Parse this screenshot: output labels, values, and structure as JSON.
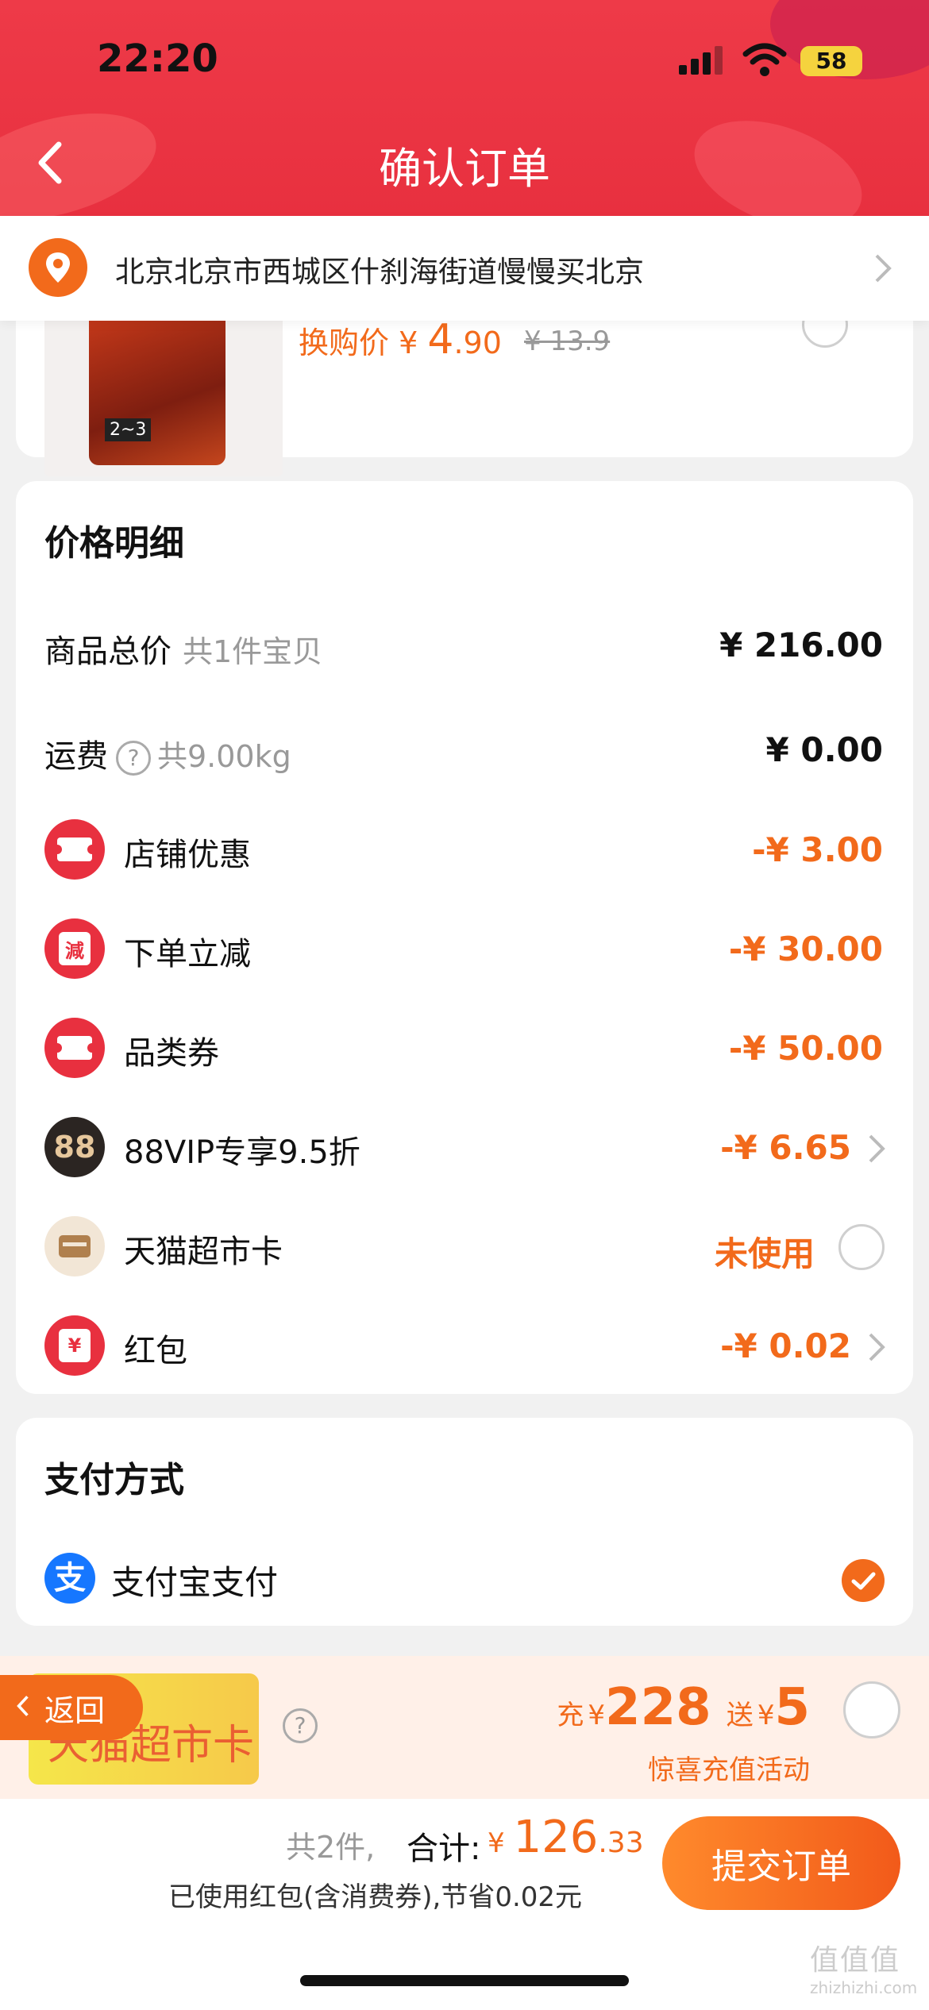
{
  "status_bar": {
    "time": "22:20",
    "battery": "58"
  },
  "header": {
    "title": "确认订单"
  },
  "address": {
    "text": "北京北京市西城区什刹海街道慢慢买北京"
  },
  "product": {
    "swap_label": "换购价 ¥ ",
    "swap_price_int": "4",
    "swap_price_dec": ".90",
    "old_price": "¥ 13.9"
  },
  "price_detail": {
    "title": "价格明细",
    "goods_total_label": "商品总价",
    "goods_total_sub": "共1件宝贝",
    "goods_total_value": "¥ 216.00",
    "shipping_label": "运费",
    "shipping_sub": "共9.00kg",
    "shipping_value": "¥ 0.00",
    "items": [
      {
        "icon": "ticket-icon",
        "label": "店铺优惠",
        "value": "-¥ 3.00"
      },
      {
        "icon": "reduce-icon",
        "icon_text": "減",
        "label": "下单立减",
        "value": "-¥ 30.00"
      },
      {
        "icon": "ticket-icon",
        "label": "品类券",
        "value": "-¥ 50.00"
      },
      {
        "icon": "88vip-icon",
        "icon_text": "88",
        "label": "88VIP专享9.5折",
        "value": "-¥ 6.65"
      },
      {
        "icon": "card-icon",
        "label": "天猫超市卡",
        "value": "未使用"
      },
      {
        "icon": "red-packet-icon",
        "icon_text": "¥",
        "label": "红包",
        "value": "-¥ 0.02"
      }
    ]
  },
  "payment": {
    "title": "支付方式",
    "method": "支付宝支付",
    "icon_text": "支"
  },
  "promo": {
    "card_label": "天猫超市卡",
    "charge_prefix": "充",
    "charge_currency": "¥",
    "charge_amount": "228",
    "gift_prefix": "送",
    "gift_currency": "¥",
    "gift_amount": "5",
    "subtitle": "惊喜充值活动"
  },
  "float_back": {
    "label": "返回"
  },
  "footer": {
    "count": "共2件,",
    "total_label": "合计:",
    "currency": "¥ ",
    "total_int": "126",
    "total_dec": ".33",
    "saving": "已使用红包(含消费券),节省0.02元",
    "submit": "提交订单"
  },
  "watermark": {
    "main": "值值值",
    "sub": "zhizhizhi.com"
  },
  "colors": {
    "accent": "#f26a1b",
    "header_red": "#e8303f",
    "alipay_blue": "#1677ff"
  }
}
